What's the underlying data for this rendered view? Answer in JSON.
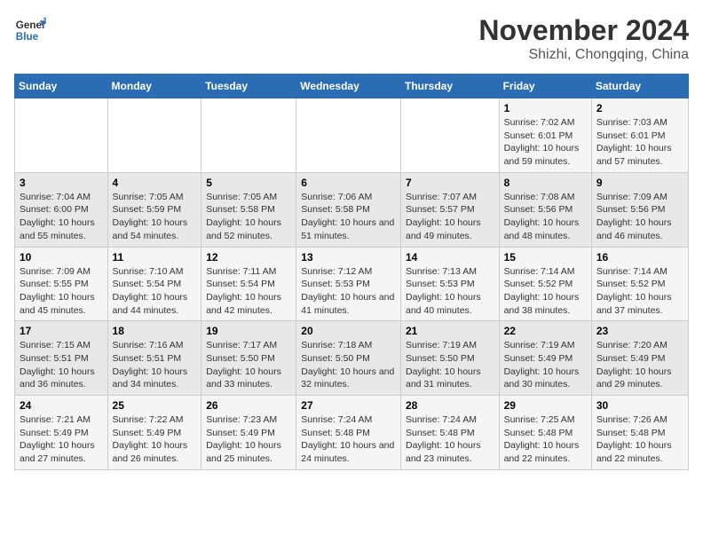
{
  "logo": {
    "line1": "General",
    "line2": "Blue"
  },
  "title": "November 2024",
  "location": "Shizhi, Chongqing, China",
  "days_of_week": [
    "Sunday",
    "Monday",
    "Tuesday",
    "Wednesday",
    "Thursday",
    "Friday",
    "Saturday"
  ],
  "weeks": [
    [
      {
        "day": "",
        "info": ""
      },
      {
        "day": "",
        "info": ""
      },
      {
        "day": "",
        "info": ""
      },
      {
        "day": "",
        "info": ""
      },
      {
        "day": "",
        "info": ""
      },
      {
        "day": "1",
        "info": "Sunrise: 7:02 AM\nSunset: 6:01 PM\nDaylight: 10 hours and 59 minutes."
      },
      {
        "day": "2",
        "info": "Sunrise: 7:03 AM\nSunset: 6:01 PM\nDaylight: 10 hours and 57 minutes."
      }
    ],
    [
      {
        "day": "3",
        "info": "Sunrise: 7:04 AM\nSunset: 6:00 PM\nDaylight: 10 hours and 55 minutes."
      },
      {
        "day": "4",
        "info": "Sunrise: 7:05 AM\nSunset: 5:59 PM\nDaylight: 10 hours and 54 minutes."
      },
      {
        "day": "5",
        "info": "Sunrise: 7:05 AM\nSunset: 5:58 PM\nDaylight: 10 hours and 52 minutes."
      },
      {
        "day": "6",
        "info": "Sunrise: 7:06 AM\nSunset: 5:58 PM\nDaylight: 10 hours and 51 minutes."
      },
      {
        "day": "7",
        "info": "Sunrise: 7:07 AM\nSunset: 5:57 PM\nDaylight: 10 hours and 49 minutes."
      },
      {
        "day": "8",
        "info": "Sunrise: 7:08 AM\nSunset: 5:56 PM\nDaylight: 10 hours and 48 minutes."
      },
      {
        "day": "9",
        "info": "Sunrise: 7:09 AM\nSunset: 5:56 PM\nDaylight: 10 hours and 46 minutes."
      }
    ],
    [
      {
        "day": "10",
        "info": "Sunrise: 7:09 AM\nSunset: 5:55 PM\nDaylight: 10 hours and 45 minutes."
      },
      {
        "day": "11",
        "info": "Sunrise: 7:10 AM\nSunset: 5:54 PM\nDaylight: 10 hours and 44 minutes."
      },
      {
        "day": "12",
        "info": "Sunrise: 7:11 AM\nSunset: 5:54 PM\nDaylight: 10 hours and 42 minutes."
      },
      {
        "day": "13",
        "info": "Sunrise: 7:12 AM\nSunset: 5:53 PM\nDaylight: 10 hours and 41 minutes."
      },
      {
        "day": "14",
        "info": "Sunrise: 7:13 AM\nSunset: 5:53 PM\nDaylight: 10 hours and 40 minutes."
      },
      {
        "day": "15",
        "info": "Sunrise: 7:14 AM\nSunset: 5:52 PM\nDaylight: 10 hours and 38 minutes."
      },
      {
        "day": "16",
        "info": "Sunrise: 7:14 AM\nSunset: 5:52 PM\nDaylight: 10 hours and 37 minutes."
      }
    ],
    [
      {
        "day": "17",
        "info": "Sunrise: 7:15 AM\nSunset: 5:51 PM\nDaylight: 10 hours and 36 minutes."
      },
      {
        "day": "18",
        "info": "Sunrise: 7:16 AM\nSunset: 5:51 PM\nDaylight: 10 hours and 34 minutes."
      },
      {
        "day": "19",
        "info": "Sunrise: 7:17 AM\nSunset: 5:50 PM\nDaylight: 10 hours and 33 minutes."
      },
      {
        "day": "20",
        "info": "Sunrise: 7:18 AM\nSunset: 5:50 PM\nDaylight: 10 hours and 32 minutes."
      },
      {
        "day": "21",
        "info": "Sunrise: 7:19 AM\nSunset: 5:50 PM\nDaylight: 10 hours and 31 minutes."
      },
      {
        "day": "22",
        "info": "Sunrise: 7:19 AM\nSunset: 5:49 PM\nDaylight: 10 hours and 30 minutes."
      },
      {
        "day": "23",
        "info": "Sunrise: 7:20 AM\nSunset: 5:49 PM\nDaylight: 10 hours and 29 minutes."
      }
    ],
    [
      {
        "day": "24",
        "info": "Sunrise: 7:21 AM\nSunset: 5:49 PM\nDaylight: 10 hours and 27 minutes."
      },
      {
        "day": "25",
        "info": "Sunrise: 7:22 AM\nSunset: 5:49 PM\nDaylight: 10 hours and 26 minutes."
      },
      {
        "day": "26",
        "info": "Sunrise: 7:23 AM\nSunset: 5:49 PM\nDaylight: 10 hours and 25 minutes."
      },
      {
        "day": "27",
        "info": "Sunrise: 7:24 AM\nSunset: 5:48 PM\nDaylight: 10 hours and 24 minutes."
      },
      {
        "day": "28",
        "info": "Sunrise: 7:24 AM\nSunset: 5:48 PM\nDaylight: 10 hours and 23 minutes."
      },
      {
        "day": "29",
        "info": "Sunrise: 7:25 AM\nSunset: 5:48 PM\nDaylight: 10 hours and 22 minutes."
      },
      {
        "day": "30",
        "info": "Sunrise: 7:26 AM\nSunset: 5:48 PM\nDaylight: 10 hours and 22 minutes."
      }
    ]
  ]
}
